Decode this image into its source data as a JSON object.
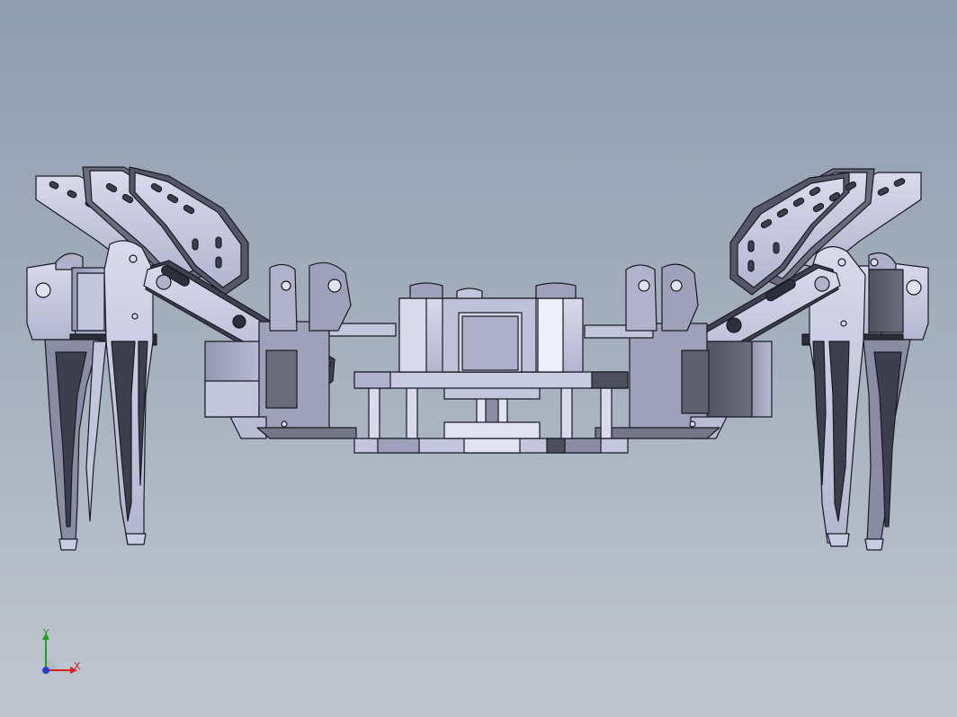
{
  "viewport": {
    "background_top": "#8f9db0",
    "background_bottom": "#c0c6ce"
  },
  "model": {
    "description_icon": "hexapod-robot-assembly",
    "part_fill_light": "#c9cbe2",
    "part_fill_mid": "#a9abc6",
    "part_fill_dark": "#5d5f6e",
    "edge_color": "#1a1a22"
  },
  "triad": {
    "y_label": "Y",
    "x_label": "X",
    "y_color": "#1aa31a",
    "x_color": "#d62020",
    "z_color": "#2040d0"
  }
}
